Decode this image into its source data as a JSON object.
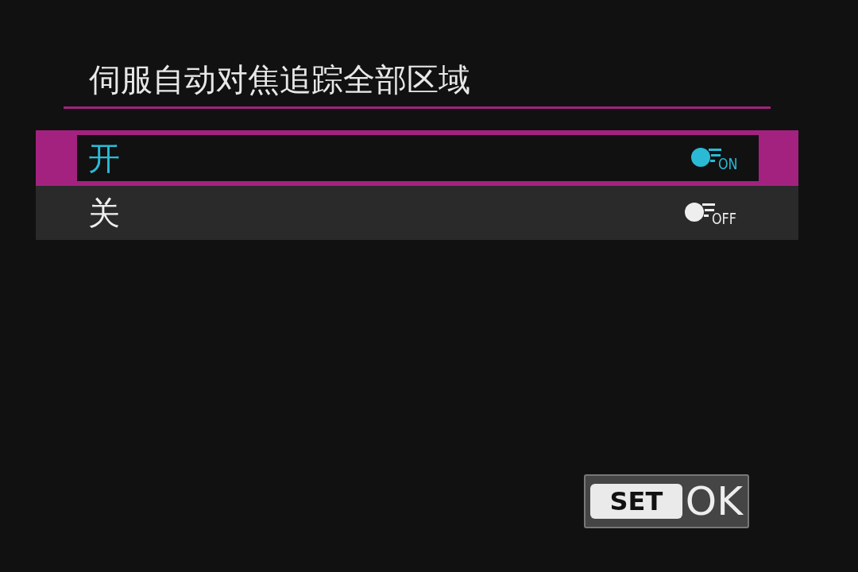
{
  "title": "伺服自动对焦追踪全部区域",
  "options": [
    {
      "label": "开",
      "icon_label": "ON",
      "selected": true
    },
    {
      "label": "关",
      "icon_label": "OFF",
      "selected": false
    }
  ],
  "set_button": {
    "key": "SET",
    "label": "OK"
  }
}
